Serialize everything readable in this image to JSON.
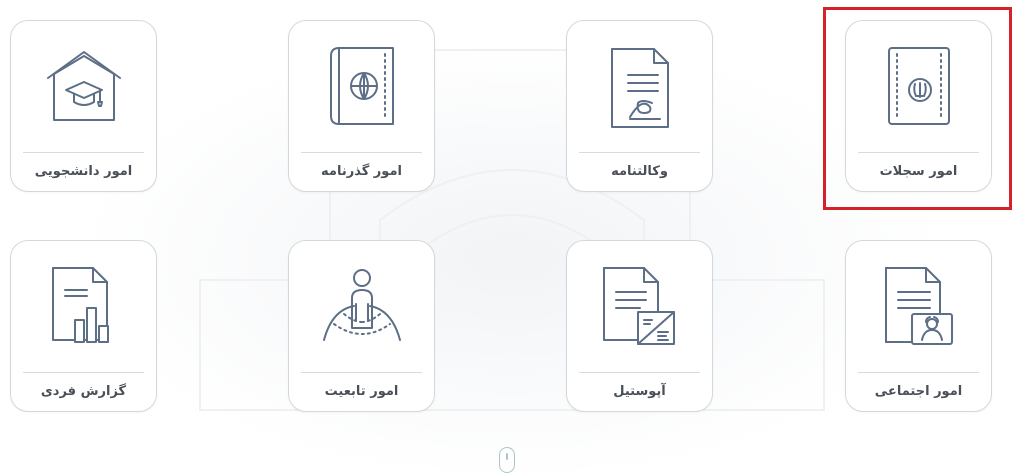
{
  "cards": [
    {
      "label": "امور سجلات",
      "icon": "passport-emblem-icon"
    },
    {
      "label": "وکالتنامه",
      "icon": "signed-document-icon"
    },
    {
      "label": "امور گذرنامه",
      "icon": "passport-globe-icon"
    },
    {
      "label": "امور دانشجویی",
      "icon": "graduation-cap-icon"
    },
    {
      "label": "امور اجتماعی",
      "icon": "document-id-card-icon"
    },
    {
      "label": "آپوستیل",
      "icon": "document-stamp-icon"
    },
    {
      "label": "امور تابعیت",
      "icon": "person-globe-icon"
    },
    {
      "label": "گزارش فردی",
      "icon": "report-chart-icon"
    }
  ],
  "colors": {
    "icon_stroke": "#5d6f86",
    "card_border": "#d4d8dc",
    "highlight": "#d3222a",
    "label_text": "#4a4f57"
  }
}
